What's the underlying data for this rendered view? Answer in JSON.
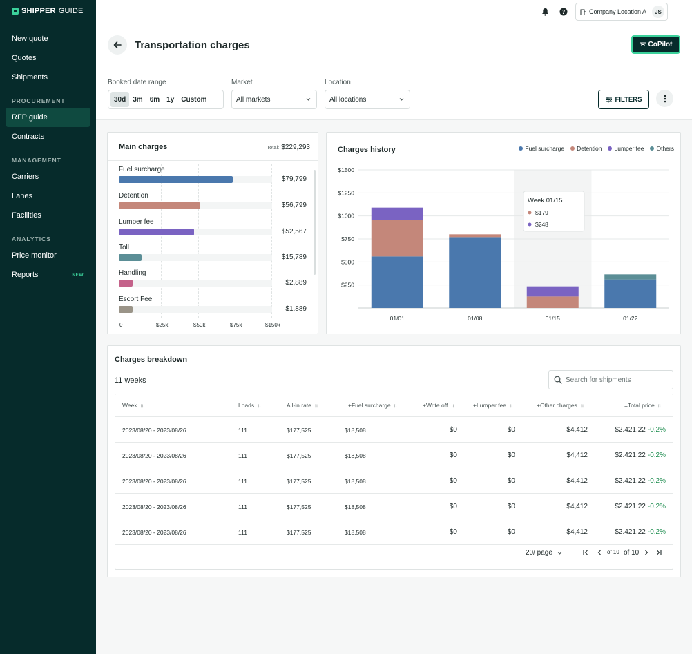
{
  "brand": {
    "name_bold": "SHIPPER",
    "name_thin": "GUIDE"
  },
  "sidebar": {
    "items_top": [
      {
        "label": "New quote"
      },
      {
        "label": "Quotes"
      },
      {
        "label": "Shipments"
      }
    ],
    "sections": [
      {
        "title": "PROCUREMENT",
        "items": [
          {
            "label": "RFP guide",
            "active": true
          },
          {
            "label": "Contracts"
          }
        ]
      },
      {
        "title": "MANAGEMENT",
        "items": [
          {
            "label": "Carriers"
          },
          {
            "label": "Lanes"
          },
          {
            "label": "Facilities"
          }
        ]
      },
      {
        "title": "ANALYTICS",
        "items": [
          {
            "label": "Price monitor"
          },
          {
            "label": "Reports",
            "badge": "NEW"
          }
        ]
      }
    ]
  },
  "topbar": {
    "location": "Company Location A",
    "avatar_initials": "JS",
    "icons": [
      "bell-icon",
      "help-icon",
      "building-icon"
    ]
  },
  "header": {
    "title": "Transportation charges",
    "copilot_label": "CoPilot"
  },
  "filters": {
    "date_range_label": "Booked date range",
    "date_options": [
      "30d",
      "3m",
      "6m",
      "1y",
      "Custom"
    ],
    "date_selected": "30d",
    "market_label": "Market",
    "market_value": "All markets",
    "location_label": "Location",
    "location_value": "All locations",
    "filters_button": "FILTERS"
  },
  "main_charges": {
    "title": "Main charges",
    "total_label": "Total:",
    "total_value": "$229,293",
    "rows": [
      {
        "label": "Fuel surcharge",
        "value_text": "$79,799",
        "value": 79799,
        "color": "#4a78ad"
      },
      {
        "label": "Detention",
        "value_text": "$56,799",
        "value": 56799,
        "color": "#c4877a"
      },
      {
        "label": "Lumper fee",
        "value_text": "$52,567",
        "value": 52567,
        "color": "#7a63c2"
      },
      {
        "label": "Toll",
        "value_text": "$15,789",
        "value": 15789,
        "color": "#5b8e96"
      },
      {
        "label": "Handling",
        "value_text": "$2,889",
        "value": 2889,
        "color": "#c4628a"
      },
      {
        "label": "Escort Fee",
        "value_text": "$1,889",
        "value": 1889,
        "color": "#9a9488"
      }
    ],
    "ticks": [
      "0",
      "$25k",
      "$50k",
      "$75k",
      "$150k"
    ]
  },
  "chart_data": {
    "type": "bar",
    "stacked": true,
    "title": "Charges history",
    "categories": [
      "01/01",
      "01/08",
      "01/15",
      "01/22"
    ],
    "series": [
      {
        "name": "Fuel surcharge",
        "color": "#4a78ad",
        "values": [
          560,
          770,
          0,
          310
        ]
      },
      {
        "name": "Detention",
        "color": "#c4877a",
        "values": [
          400,
          30,
          125,
          0
        ]
      },
      {
        "name": "Lumper fee",
        "color": "#7a63c2",
        "values": [
          130,
          0,
          110,
          0
        ]
      },
      {
        "name": "Others",
        "color": "#5b8e96",
        "values": [
          0,
          0,
          0,
          55
        ]
      }
    ],
    "yticks": [
      "$1500",
      "$1250",
      "$1000",
      "$750",
      "$500",
      "$250"
    ],
    "ylim": [
      0,
      1500
    ],
    "grid": true,
    "legend_position": "top-right",
    "highlight_category": "01/15",
    "tooltip": {
      "title": "Week 01/15",
      "entries": [
        {
          "text": "$179",
          "color": "#c4877a"
        },
        {
          "text": "$248",
          "color": "#7a63c2"
        }
      ]
    }
  },
  "breakdown": {
    "title": "Charges breakdown",
    "count_text": "11 weeks",
    "search_placeholder": "Search for shipments",
    "columns": [
      "Week",
      "Loads",
      "All-in rate",
      "+Fuel surcharge",
      "+Write off",
      "+Lumper fee",
      "+Other charges",
      "=Total price"
    ],
    "rows": [
      {
        "week": "2023/08/20 - 2023/08/26",
        "loads": "111",
        "allin": "$177,525",
        "fuel": "$18,508",
        "writeoff": "$0",
        "lumper": "$0",
        "other": "$4,412",
        "total": "$2.421,22",
        "pct": "-0.2%"
      },
      {
        "week": "2023/08/20 - 2023/08/26",
        "loads": "111",
        "allin": "$177,525",
        "fuel": "$18,508",
        "writeoff": "$0",
        "lumper": "$0",
        "other": "$4,412",
        "total": "$2.421,22",
        "pct": "-0.2%"
      },
      {
        "week": "2023/08/20 - 2023/08/26",
        "loads": "111",
        "allin": "$177,525",
        "fuel": "$18,508",
        "writeoff": "$0",
        "lumper": "$0",
        "other": "$4,412",
        "total": "$2.421,22",
        "pct": "-0.2%"
      },
      {
        "week": "2023/08/20 - 2023/08/26",
        "loads": "111",
        "allin": "$177,525",
        "fuel": "$18,508",
        "writeoff": "$0",
        "lumper": "$0",
        "other": "$4,412",
        "total": "$2.421,22",
        "pct": "-0.2%"
      },
      {
        "week": "2023/08/20 - 2023/08/26",
        "loads": "111",
        "allin": "$177,525",
        "fuel": "$18,508",
        "writeoff": "$0",
        "lumper": "$0",
        "other": "$4,412",
        "total": "$2.421,22",
        "pct": "-0.2%"
      }
    ],
    "pagination": {
      "page_size": "20/ page",
      "current_of": "of 10",
      "total_of": "of 10"
    }
  }
}
